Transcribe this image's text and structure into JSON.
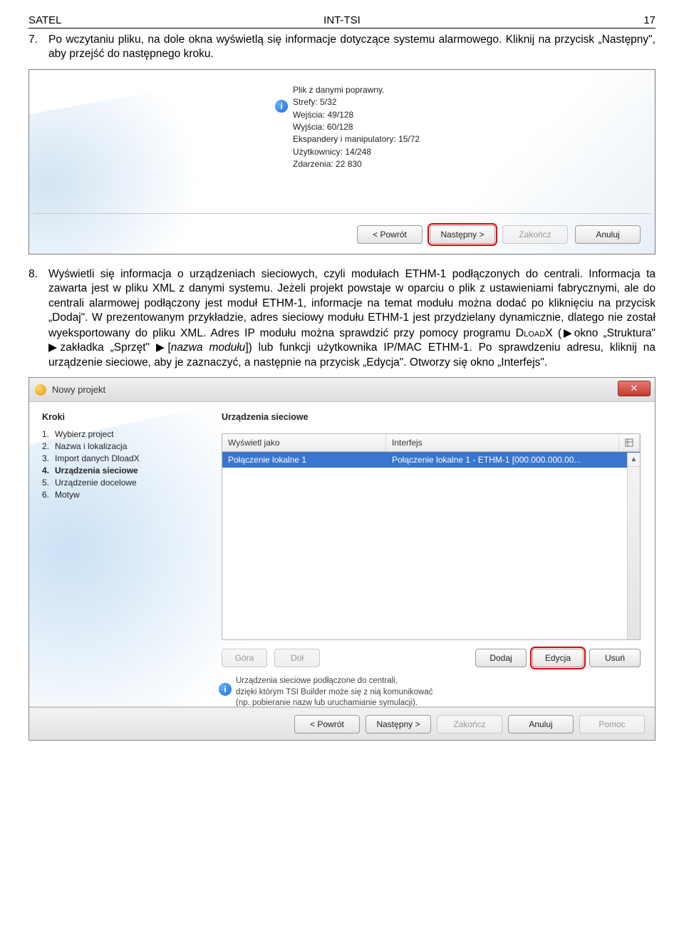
{
  "header": {
    "left": "SATEL",
    "center": "INT-TSI",
    "right": "17"
  },
  "para7": {
    "num": "7.",
    "text": "Po wczytaniu pliku, na dole okna wyświetlą się informacje dotyczące systemu alarmowego. Kliknij na przycisk „Następny\", aby przejść do następnego kroku."
  },
  "shot1": {
    "info_lines": [
      "Plik z danymi poprawny.",
      "Strefy: 5/32",
      "Wejścia: 49/128",
      "Wyjścia: 60/128",
      "Ekspandery i manipulatory: 15/72",
      "Użytkownicy: 14/248",
      "Zdarzenia: 22 830"
    ],
    "btn_back": "< Powrót",
    "btn_next": "Następny >",
    "btn_finish": "Zakończ",
    "btn_cancel": "Anuluj"
  },
  "para8": {
    "num": "8.",
    "text_a": "Wyświetli się informacja o urządzeniach sieciowych, czyli modułach ETHM-1 podłączonych do centrali. Informacja ta zawarta jest w pliku XML z danymi systemu. Jeżeli projekt powstaje w oparciu o plik z ustawieniami fabrycznymi, ale do centrali alarmowej podłączony jest moduł ETHM-1, informacje na temat modułu można dodać po kliknięciu na przycisk „Dodaj\". W prezentowanym przykładzie, adres sieciowy modułu ETHM-1 jest przydzielany dynamicznie, dlatego nie został wyeksportowany do pliku XML. Adres IP modułu można sprawdzić przy pomocy programu ",
    "dloadx": "DloadX",
    "text_b": " (▶okno „Struktura\" ▶zakładka „Sprzęt\" ▶[",
    "italic": "nazwa modułu",
    "text_c": "]) lub funkcji użytkownika IP/MAC ETHM-1. Po sprawdzeniu adresu, kliknij na urządzenie sieciowe, aby je zaznaczyć, a następnie na przycisk „Edycja\". Otworzy się okno „Interfejs\"."
  },
  "shot2": {
    "title": "Nowy projekt",
    "steps_title": "Kroki",
    "steps": [
      {
        "n": "1.",
        "label": "Wybierz project"
      },
      {
        "n": "2.",
        "label": "Nazwa i lokalizacja"
      },
      {
        "n": "3.",
        "label": "Import danych DloadX"
      },
      {
        "n": "4.",
        "label": "Urządzenia sieciowe",
        "current": true
      },
      {
        "n": "5.",
        "label": "Urządzenie docelowe"
      },
      {
        "n": "6.",
        "label": "Motyw"
      }
    ],
    "panel_title": "Urządzenia sieciowe",
    "col1": "Wyświetl jako",
    "col2": "Interfejs",
    "row_display": "Połączenie lokalne 1",
    "row_iface": "Połączenie lokalne 1 - ETHM-1 [000.000.000.00...",
    "btn_up": "Góra",
    "btn_down": "Dół",
    "btn_add": "Dodaj",
    "btn_edit": "Edycja",
    "btn_del": "Usuń",
    "hint1": "Urządzenia sieciowe podłączone do centrali,",
    "hint2": "dzięki którym TSI Builder może się z nią komunikować",
    "hint3": "(np. pobieranie nazw lub uruchamianie symulacji).",
    "btn_back": "< Powrót",
    "btn_next": "Następny >",
    "btn_finish": "Zakończ",
    "btn_cancel": "Anuluj",
    "btn_help": "Pomoc"
  }
}
